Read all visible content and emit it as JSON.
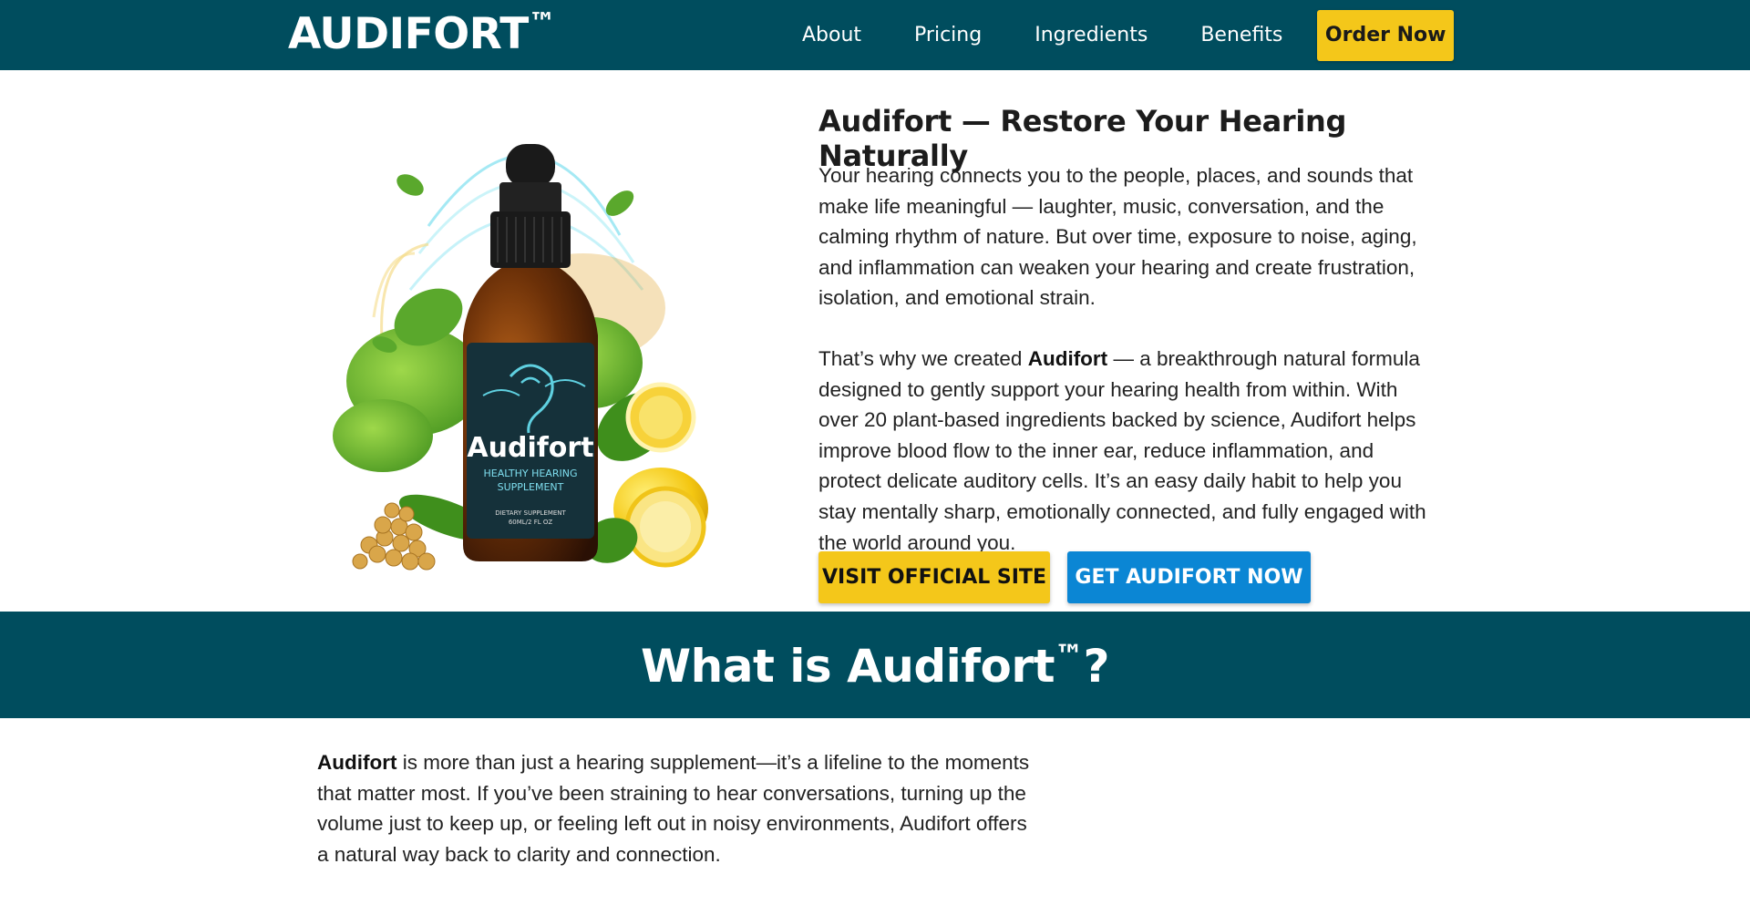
{
  "header": {
    "logo": "AUDIFORT",
    "logo_tm": "™",
    "nav": [
      "About",
      "Pricing",
      "Ingredients",
      "Benefits"
    ],
    "order_button": "Order Now"
  },
  "hero": {
    "product_image": {
      "brand": "Audifort",
      "label_line1": "HEALTHY HEARING",
      "label_line2": "SUPPLEMENT",
      "small_line1": "DIETARY SUPPLEMENT",
      "small_line2": "60ML/2 FL OZ"
    },
    "title": "Audifort — Restore Your Hearing Naturally",
    "paragraph1": "Your hearing connects you to the people, places, and sounds that make life meaningful — laughter, music, conversation, and the calming rhythm of nature. But over time, exposure to noise, aging, and inflammation can weaken your hearing and create frustration, isolation, and emotional strain.",
    "paragraph2_prefix": "That’s why we created ",
    "paragraph2_bold": "Audifort",
    "paragraph2_rest": " — a breakthrough natural formula designed to gently support your hearing health from within. With over 20 plant-based ingredients backed by science, Audifort helps improve blood flow to the inner ear, reduce inflammation, and protect delicate auditory cells. It’s an easy daily habit to help you stay mentally sharp, emotionally connected, and fully engaged with the world around you.",
    "visit_button": "VISIT OFFICIAL SITE",
    "get_button": "GET AUDIFORT NOW"
  },
  "section": {
    "title": "What is Audifort",
    "title_tm": "™",
    "title_end": "?",
    "about_bold": "Audifort",
    "about_rest": " is more than just a hearing supplement—it’s a lifeline to the moments that matter most. If you’ve been straining to hear conversations, turning up the volume just to keep up, or feeling left out in noisy environments, Audifort offers a natural way back to clarity and connection."
  },
  "colors": {
    "brand_teal": "#004d5e",
    "accent_yellow": "#f4c71a",
    "accent_blue": "#0b86d4"
  }
}
